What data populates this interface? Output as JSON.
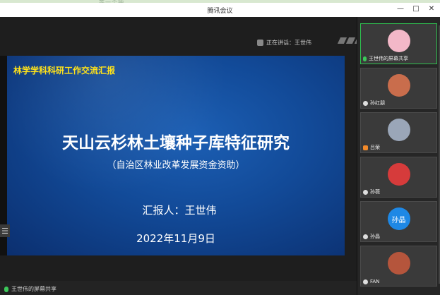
{
  "window": {
    "title": "腾讯会议",
    "minimize_glyph": "—",
    "maximize_glyph": "□",
    "close_glyph": "✕",
    "background_tab_text": "等一个钟..."
  },
  "stage": {
    "speaking_label": "正在讲话：王世伟",
    "bottom_label": "王世伟的屏幕共享",
    "handle_glyph": "☰"
  },
  "slide": {
    "header": "林学学科科研工作交流汇报",
    "title": "天山云杉林土壤种子库特征研究",
    "subtitle": "（自治区林业改革发展资金资助）",
    "reporter": "汇报人：王世伟",
    "date": "2022年11月9日",
    "header_color": "#ffe21a",
    "background_color": "#124a98"
  },
  "participants": [
    {
      "name": "王世伟的屏幕共享",
      "avatar_text": "",
      "avatar_color": "#f3b8c8",
      "active": true,
      "icon": "mic-icon"
    },
    {
      "name": "孙红朋",
      "avatar_text": "",
      "avatar_color": "#c96d4c",
      "active": false,
      "icon": "user-icon"
    },
    {
      "name": "吕荣",
      "avatar_text": "",
      "avatar_color": "#9aa6b8",
      "active": false,
      "icon": "user-icon"
    },
    {
      "name": "孙薇",
      "avatar_text": "",
      "avatar_color": "#d63b3b",
      "active": false,
      "icon": "user-icon"
    },
    {
      "name": "孙晶",
      "avatar_text": "孙晶",
      "avatar_color": "#1e88e5",
      "active": false,
      "icon": "user-icon"
    },
    {
      "name": "FAN",
      "avatar_text": "",
      "avatar_color": "#b5553c",
      "active": false,
      "icon": "user-icon"
    }
  ]
}
